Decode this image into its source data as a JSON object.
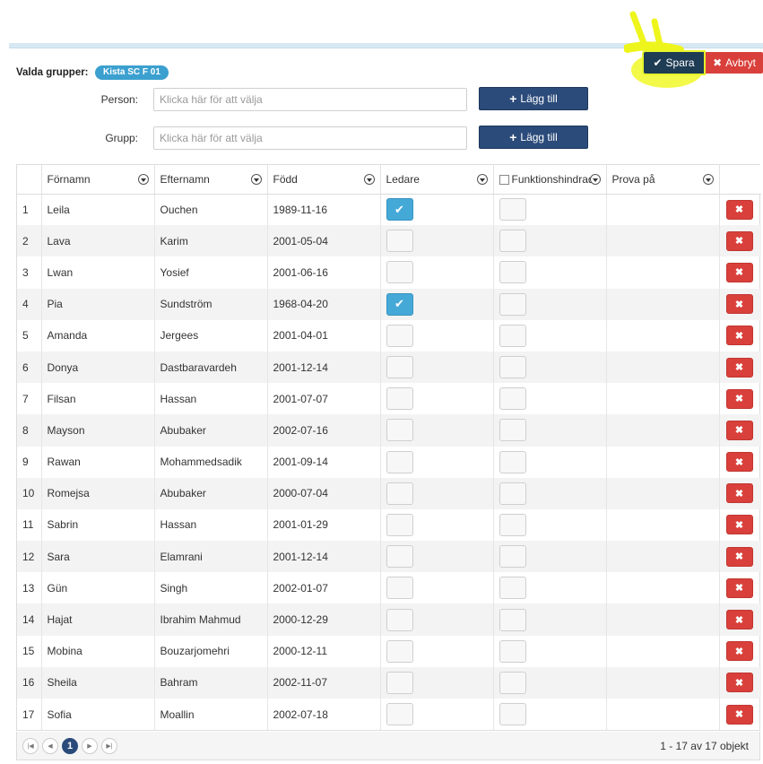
{
  "toolbar": {
    "save_label": "Spara",
    "cancel_label": "Avbryt"
  },
  "groups": {
    "label": "Valda grupper:",
    "selected": "Kista SC F 01"
  },
  "form": {
    "person_label": "Person:",
    "person_placeholder": "Klicka här för att välja",
    "group_label": "Grupp:",
    "group_placeholder": "Klicka här för att välja",
    "add_label": "Lägg till"
  },
  "table": {
    "columns": [
      "Förnamn",
      "Efternamn",
      "Född",
      "Ledare",
      "Funktionshindrad",
      "Prova på"
    ],
    "rows": [
      {
        "num": "1",
        "first": "Leila",
        "last": "Ouchen",
        "born": "1989-11-16",
        "leader": true,
        "disabled": false
      },
      {
        "num": "2",
        "first": "Lava",
        "last": "Karim",
        "born": "2001-05-04",
        "leader": false,
        "disabled": false
      },
      {
        "num": "3",
        "first": "Lwan",
        "last": "Yosief",
        "born": "2001-06-16",
        "leader": false,
        "disabled": false
      },
      {
        "num": "4",
        "first": "Pia",
        "last": "Sundström",
        "born": "1968-04-20",
        "leader": true,
        "disabled": false
      },
      {
        "num": "5",
        "first": "Amanda",
        "last": "Jergees",
        "born": "2001-04-01",
        "leader": false,
        "disabled": false
      },
      {
        "num": "6",
        "first": "Donya",
        "last": "Dastbaravardeh",
        "born": "2001-12-14",
        "leader": false,
        "disabled": false
      },
      {
        "num": "7",
        "first": "Filsan",
        "last": "Hassan",
        "born": "2001-07-07",
        "leader": false,
        "disabled": false
      },
      {
        "num": "8",
        "first": "Mayson",
        "last": "Abubaker",
        "born": "2002-07-16",
        "leader": false,
        "disabled": false
      },
      {
        "num": "9",
        "first": "Rawan",
        "last": "Mohammedsadik",
        "born": "2001-09-14",
        "leader": false,
        "disabled": false
      },
      {
        "num": "10",
        "first": "Romejsa",
        "last": "Abubaker",
        "born": "2000-07-04",
        "leader": false,
        "disabled": false
      },
      {
        "num": "11",
        "first": "Sabrin",
        "last": "Hassan",
        "born": "2001-01-29",
        "leader": false,
        "disabled": false
      },
      {
        "num": "12",
        "first": "Sara",
        "last": "Elamrani",
        "born": "2001-12-14",
        "leader": false,
        "disabled": false
      },
      {
        "num": "13",
        "first": "Gün",
        "last": "Singh",
        "born": "2002-01-07",
        "leader": false,
        "disabled": false
      },
      {
        "num": "14",
        "first": "Hajat",
        "last": "Ibrahim Mahmud",
        "born": "2000-12-29",
        "leader": false,
        "disabled": false
      },
      {
        "num": "15",
        "first": "Mobina",
        "last": "Bouzarjomehri",
        "born": "2000-12-11",
        "leader": false,
        "disabled": false
      },
      {
        "num": "16",
        "first": "Sheila",
        "last": "Bahram",
        "born": "2002-11-07",
        "leader": false,
        "disabled": false
      },
      {
        "num": "17",
        "first": "Sofia",
        "last": "Moallin",
        "born": "2002-07-18",
        "leader": false,
        "disabled": false
      }
    ]
  },
  "pager": {
    "current_page": "1",
    "info": "1 - 17 av 17 objekt"
  },
  "colors": {
    "save": "#1f3c55",
    "cancel": "#d9403b",
    "add": "#2b4b7a",
    "badge": "#3ba0cf",
    "check_on": "#45a9d8",
    "highlight": "#e6f52c"
  },
  "icons": {
    "save": "checkmark-icon",
    "cancel": "close-icon",
    "add": "plus-icon",
    "filter": "filter-icon",
    "delete": "delete-icon"
  }
}
